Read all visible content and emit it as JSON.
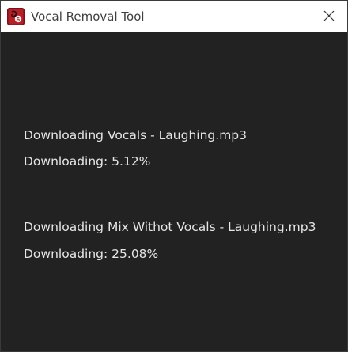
{
  "window": {
    "title": "Vocal Removal Tool",
    "app_icon": "app-logo-icon",
    "close_icon": "close-icon"
  },
  "downloads": [
    {
      "heading": "Downloading Vocals - Laughing.mp3",
      "status": "Downloading: 5.12%"
    },
    {
      "heading": "Downloading Mix Withot Vocals - Laughing.mp3",
      "status": "Downloading: 25.08%"
    }
  ],
  "colors": {
    "background": "#222222",
    "text": "#e6e6e6",
    "titlebar": "#ffffff",
    "icon_red": "#b3202a"
  }
}
